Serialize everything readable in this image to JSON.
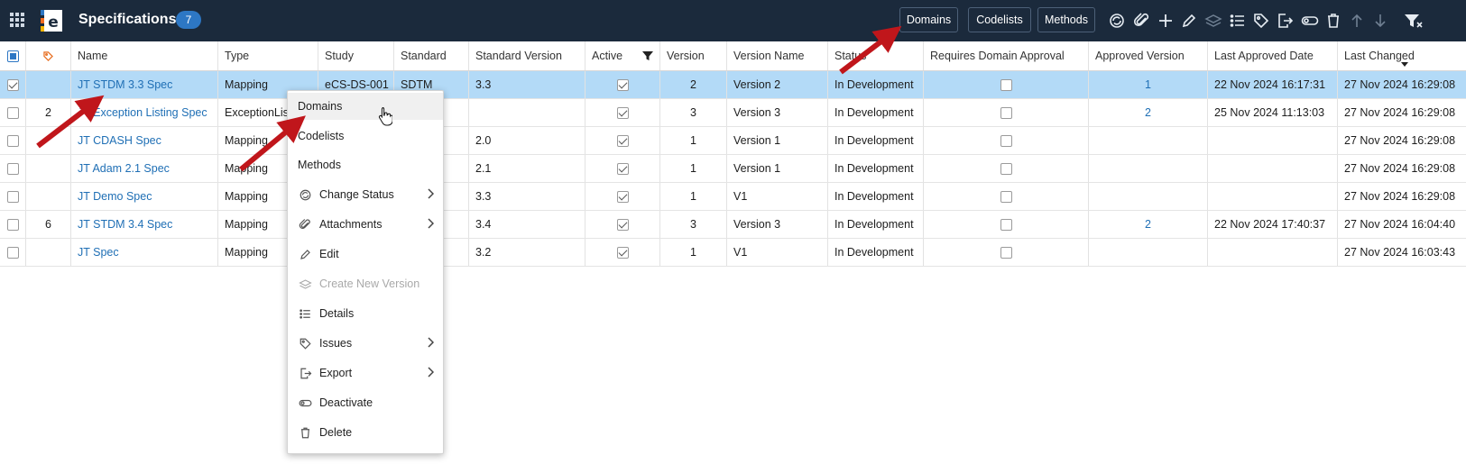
{
  "header": {
    "title": "Specifications",
    "count": "7",
    "buttons": {
      "domains": "Domains",
      "codelists": "Codelists",
      "methods": "Methods"
    }
  },
  "grid": {
    "columns": [
      "",
      "",
      "Name",
      "Type",
      "Study",
      "Standard",
      "Standard Version",
      "Active",
      "Version",
      "Version Name",
      "Status",
      "Requires Domain Approval",
      "Approved Version",
      "Last Approved Date",
      "Last Changed"
    ],
    "rows": [
      {
        "selected": true,
        "issues": "",
        "name": "JT STDM 3.3 Spec",
        "type": "Mapping",
        "study": "eCS-DS-001",
        "standard": "SDTM",
        "standard_version": "3.3",
        "active": true,
        "version": "2",
        "version_name": "Version 2",
        "status": "In Development",
        "requires_approval": false,
        "approved_version": "1",
        "last_approved": "22 Nov 2024 16:17:31",
        "last_changed": "27 Nov 2024 16:29:08"
      },
      {
        "selected": false,
        "issues": "2",
        "name": "JT Exception Listing Spec",
        "type": "ExceptionLis",
        "study": "",
        "standard": "",
        "standard_version": "",
        "active": true,
        "version": "3",
        "version_name": "Version 3",
        "status": "In Development",
        "requires_approval": false,
        "approved_version": "2",
        "last_approved": "25 Nov 2024 11:13:03",
        "last_changed": "27 Nov 2024 16:29:08"
      },
      {
        "selected": false,
        "issues": "",
        "name": "JT CDASH Spec",
        "type": "Mapping",
        "study": "",
        "standard": "",
        "standard_version": "2.0",
        "active": true,
        "version": "1",
        "version_name": "Version 1",
        "status": "In Development",
        "requires_approval": false,
        "approved_version": "",
        "last_approved": "",
        "last_changed": "27 Nov 2024 16:29:08"
      },
      {
        "selected": false,
        "issues": "",
        "name": "JT Adam 2.1 Spec",
        "type": "Mapping",
        "study": "",
        "standard": "",
        "standard_version": "2.1",
        "active": true,
        "version": "1",
        "version_name": "Version 1",
        "status": "In Development",
        "requires_approval": false,
        "approved_version": "",
        "last_approved": "",
        "last_changed": "27 Nov 2024 16:29:08"
      },
      {
        "selected": false,
        "issues": "",
        "name": "JT Demo Spec",
        "type": "Mapping",
        "study": "",
        "standard": "",
        "standard_version": "3.3",
        "active": true,
        "version": "1",
        "version_name": "V1",
        "status": "In Development",
        "requires_approval": false,
        "approved_version": "",
        "last_approved": "",
        "last_changed": "27 Nov 2024 16:29:08"
      },
      {
        "selected": false,
        "issues": "6",
        "name": "JT STDM 3.4 Spec",
        "type": "Mapping",
        "study": "",
        "standard": "",
        "standard_version": "3.4",
        "active": true,
        "version": "3",
        "version_name": "Version 3",
        "status": "In Development",
        "requires_approval": false,
        "approved_version": "2",
        "last_approved": "22 Nov 2024 17:40:37",
        "last_changed": "27 Nov 2024 16:04:40"
      },
      {
        "selected": false,
        "issues": "",
        "name": "JT Spec",
        "type": "Mapping",
        "study": "",
        "standard": "",
        "standard_version": "3.2",
        "active": true,
        "version": "1",
        "version_name": "V1",
        "status": "In Development",
        "requires_approval": false,
        "approved_version": "",
        "last_approved": "",
        "last_changed": "27 Nov 2024 16:03:43"
      }
    ]
  },
  "context_menu": {
    "items": [
      {
        "label": "Domains",
        "icon": "",
        "submenu": false,
        "disabled": false,
        "hover": true
      },
      {
        "label": "Codelists",
        "icon": "",
        "submenu": false,
        "disabled": false
      },
      {
        "label": "Methods",
        "icon": "",
        "submenu": false,
        "disabled": false
      },
      {
        "label": "Change Status",
        "icon": "status-cycle-icon",
        "submenu": true,
        "disabled": false
      },
      {
        "label": "Attachments",
        "icon": "paperclip-icon",
        "submenu": true,
        "disabled": false
      },
      {
        "label": "Edit",
        "icon": "pencil-icon",
        "submenu": false,
        "disabled": false
      },
      {
        "label": "Create New Version",
        "icon": "layers-icon",
        "submenu": false,
        "disabled": true
      },
      {
        "label": "Details",
        "icon": "list-icon",
        "submenu": false,
        "disabled": false
      },
      {
        "label": "Issues",
        "icon": "tag-icon",
        "submenu": true,
        "disabled": false
      },
      {
        "label": "Export",
        "icon": "export-icon",
        "submenu": true,
        "disabled": false
      },
      {
        "label": "Deactivate",
        "icon": "toggle-icon",
        "submenu": false,
        "disabled": false
      },
      {
        "label": "Delete",
        "icon": "trash-icon",
        "submenu": false,
        "disabled": false
      }
    ]
  },
  "colors": {
    "topbar": "#1b2a3c",
    "accent": "#2d77c4",
    "link": "#1f6fb5",
    "selected_row": "#b3daf7",
    "annotation_arrow": "#c0161b"
  }
}
